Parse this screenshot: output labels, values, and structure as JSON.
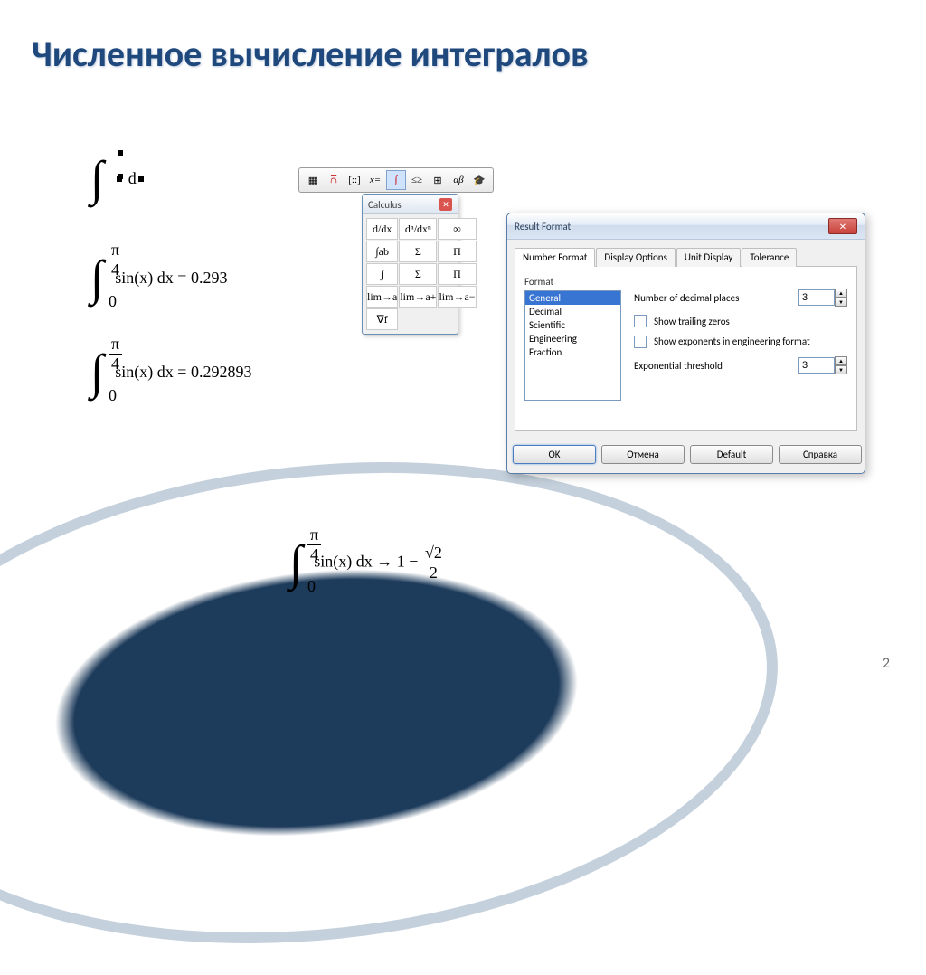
{
  "title": "Численное вычисление интегралов",
  "page_number": "2",
  "integrals": {
    "template_d": "d",
    "eq2": {
      "upper_num": "π",
      "upper_den": "4",
      "lower": "0",
      "body": "sin(x) dx = 0.293"
    },
    "eq3": {
      "upper_num": "π",
      "upper_den": "4",
      "lower": "0",
      "body": "sin(x) dx = 0.292893"
    },
    "eq4": {
      "upper_num": "π",
      "upper_den": "4",
      "lower": "0",
      "body_prefix": "sin(x) dx → 1 − ",
      "frac_num": "√2",
      "frac_den": "2"
    }
  },
  "calculus_palette": {
    "title": "Calculus",
    "cells": [
      "d/dx",
      "dⁿ/dxⁿ",
      "∞",
      "∫ab",
      "Σ",
      "Π",
      "∫",
      "Σ",
      "Π",
      "lim→a",
      "lim→a+",
      "lim→a−",
      "∇f",
      "",
      ""
    ]
  },
  "dialog": {
    "title": "Result Format",
    "tabs": [
      "Number Format",
      "Display Options",
      "Unit Display",
      "Tolerance"
    ],
    "format_label": "Format",
    "format_options": [
      "General",
      "Decimal",
      "Scientific",
      "Engineering",
      "Fraction"
    ],
    "format_selected": "General",
    "decimal_label": "Number of decimal places",
    "decimal_value": "3",
    "trailing_label": "Show trailing zeros",
    "engfmt_label": "Show exponents in engineering format",
    "expthresh_label": "Exponential threshold",
    "expthresh_value": "3",
    "buttons": {
      "ok": "OK",
      "cancel": "Отмена",
      "default": "Default",
      "help": "Справка"
    }
  }
}
